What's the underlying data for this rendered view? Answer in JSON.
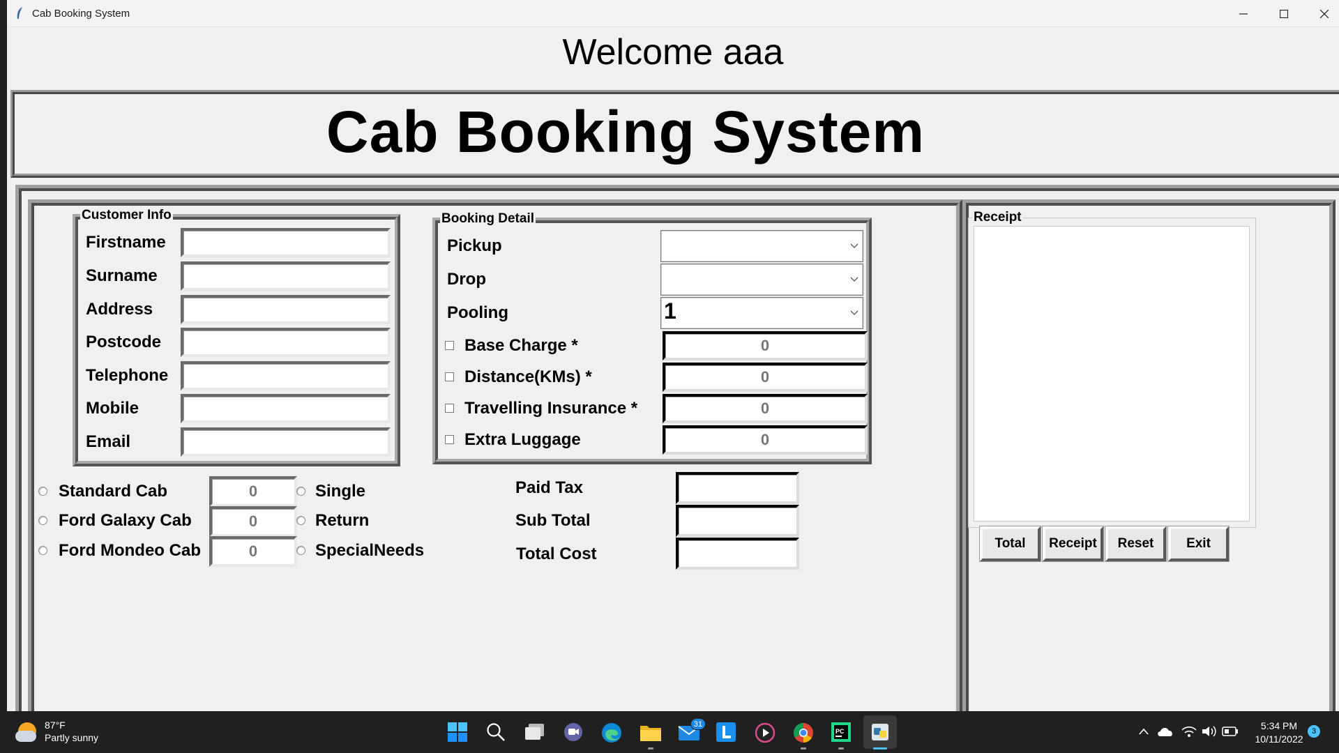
{
  "window": {
    "title": "Cab Booking System"
  },
  "welcome": "Welcome aaa",
  "banner": "Cab Booking System",
  "customer_info": {
    "title": "Customer Info",
    "fields": [
      {
        "label": "Firstname",
        "value": ""
      },
      {
        "label": "Surname",
        "value": ""
      },
      {
        "label": "Address",
        "value": ""
      },
      {
        "label": "Postcode",
        "value": ""
      },
      {
        "label": "Telephone",
        "value": ""
      },
      {
        "label": "Mobile",
        "value": ""
      },
      {
        "label": "Email",
        "value": ""
      }
    ]
  },
  "booking": {
    "title": "Booking Detail",
    "pickup": {
      "label": "Pickup",
      "value": ""
    },
    "drop": {
      "label": "Drop",
      "value": ""
    },
    "pooling": {
      "label": "Pooling",
      "value": "1"
    },
    "charges": [
      {
        "label": "Base Charge *",
        "value": "0",
        "checked": false
      },
      {
        "label": "Distance(KMs) *",
        "value": "0",
        "checked": false
      },
      {
        "label": "Travelling Insurance *",
        "value": "0",
        "checked": false
      },
      {
        "label": "Extra Luggage",
        "value": "0",
        "checked": false
      }
    ]
  },
  "cab_types": [
    {
      "label": "Standard Cab",
      "value": "0"
    },
    {
      "label": "Ford Galaxy Cab",
      "value": "0"
    },
    {
      "label": "Ford Mondeo Cab",
      "value": "0"
    }
  ],
  "journey_types": [
    {
      "label": "Single"
    },
    {
      "label": "Return"
    },
    {
      "label": "SpecialNeeds"
    }
  ],
  "totals": [
    {
      "label": "Paid Tax",
      "value": ""
    },
    {
      "label": "Sub Total",
      "value": ""
    },
    {
      "label": "Total Cost",
      "value": ""
    }
  ],
  "receipt": {
    "title": "Receipt",
    "content": "",
    "buttons": {
      "total": "Total",
      "receipt": "Receipt",
      "reset": "Reset",
      "exit": "Exit"
    }
  },
  "taskbar": {
    "weather": {
      "temp": "87°F",
      "desc": "Partly sunny"
    },
    "mail_badge": "31",
    "clock": {
      "time": "5:34 PM",
      "date": "10/11/2022"
    },
    "notification_count": "3"
  },
  "colors": {
    "window_bg": "#f0f0f0",
    "taskbar_bg": "#202020",
    "accent": "#0078d4"
  }
}
